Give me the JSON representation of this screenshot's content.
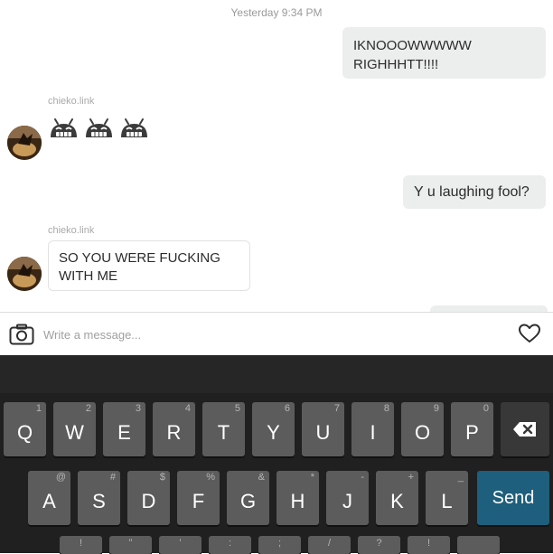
{
  "chat": {
    "timestamp": "Yesterday 9:34 PM",
    "messages": [
      {
        "direction": "outgoing",
        "text_lines": [
          "IKNOOOWWWWW",
          "RIGHHHTT!!!!"
        ]
      },
      {
        "direction": "incoming",
        "sender": "chieko.link",
        "emoji": [
          "grinning-robot-emoji",
          "grinning-robot-emoji",
          "grinning-robot-emoji"
        ]
      },
      {
        "direction": "outgoing",
        "text": "Y u laughing fool?"
      },
      {
        "direction": "incoming",
        "sender": "chieko.link",
        "text_lines": [
          "SO YOU WERE FUCKING",
          "WITH ME"
        ]
      }
    ]
  },
  "composer": {
    "placeholder": "Write a message...",
    "camera_icon": "camera-icon",
    "like_icon": "heart-icon"
  },
  "keyboard": {
    "row1": [
      {
        "main": "Q",
        "sub": "1"
      },
      {
        "main": "W",
        "sub": "2"
      },
      {
        "main": "E",
        "sub": "3"
      },
      {
        "main": "R",
        "sub": "4"
      },
      {
        "main": "T",
        "sub": "5"
      },
      {
        "main": "Y",
        "sub": "6"
      },
      {
        "main": "U",
        "sub": "7"
      },
      {
        "main": "I",
        "sub": "8"
      },
      {
        "main": "O",
        "sub": "9"
      },
      {
        "main": "P",
        "sub": "0"
      }
    ],
    "row2": [
      {
        "main": "A",
        "sub": "@"
      },
      {
        "main": "S",
        "sub": "#"
      },
      {
        "main": "D",
        "sub": "$"
      },
      {
        "main": "F",
        "sub": "%"
      },
      {
        "main": "G",
        "sub": "&"
      },
      {
        "main": "H",
        "sub": "*"
      },
      {
        "main": "J",
        "sub": "-"
      },
      {
        "main": "K",
        "sub": "+"
      },
      {
        "main": "L",
        "sub": "_"
      }
    ],
    "row3_subs": [
      "!",
      "\"",
      "'",
      ":",
      ";",
      "/",
      "?",
      "!"
    ],
    "send_label": "Send",
    "delete_icon": "backspace-icon",
    "colors": {
      "background": "#202020",
      "key": "#5c5c5c",
      "send": "#1d5f7c"
    }
  }
}
